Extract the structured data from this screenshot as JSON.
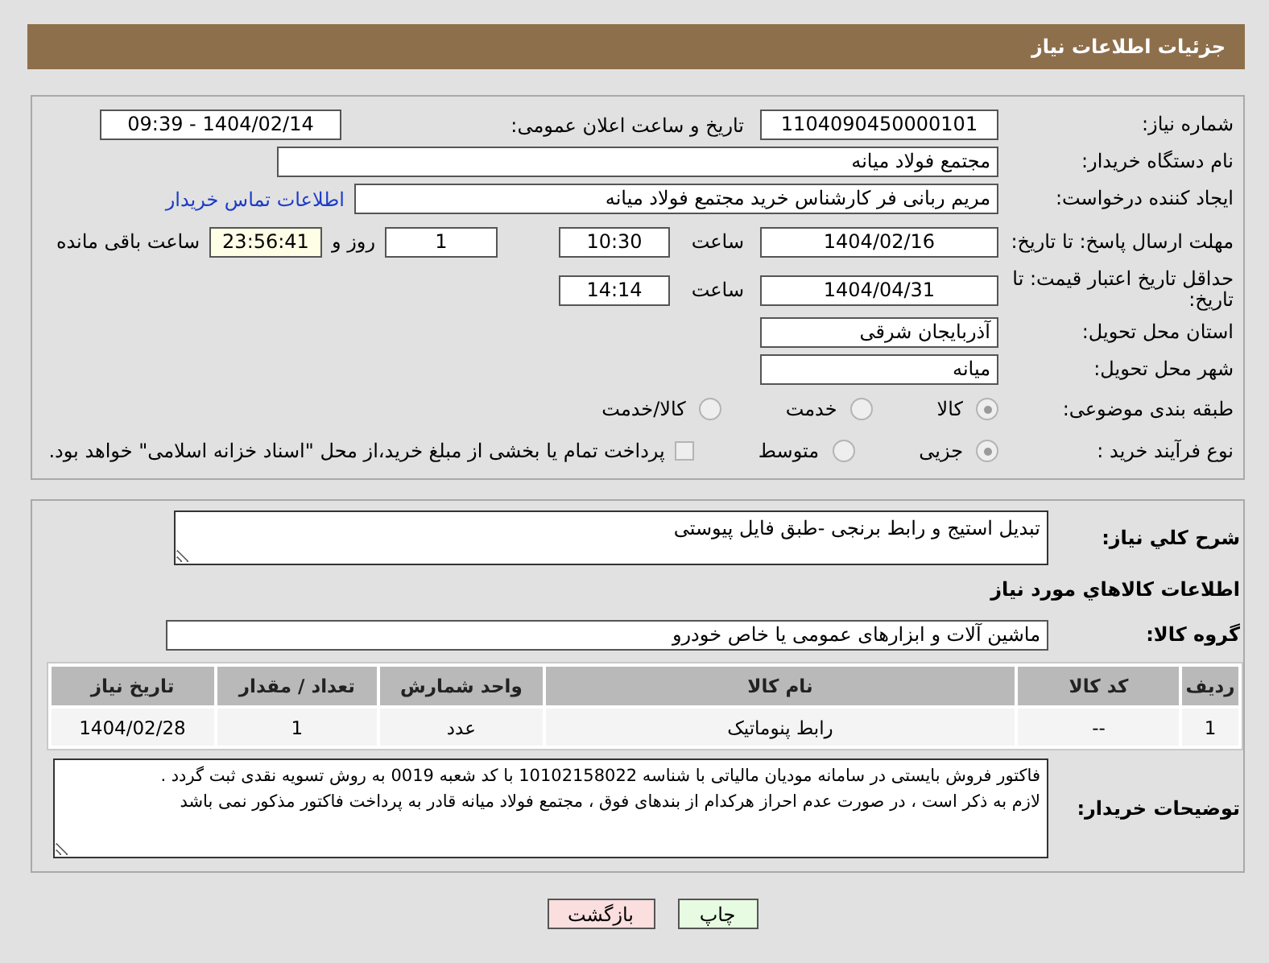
{
  "header": {
    "title": "جزئیات اطلاعات نیاز"
  },
  "need_number": {
    "label": "شماره نیاز:",
    "value": "1104090450000101"
  },
  "announce": {
    "label": "تاریخ و ساعت اعلان عمومی:",
    "value": "1404/02/14 - 09:39"
  },
  "buyer_org": {
    "label": "نام دستگاه خریدار:",
    "value": "مجتمع فولاد میانه"
  },
  "requester": {
    "label": "ایجاد کننده درخواست:",
    "value": "مریم ربانی فر کارشناس خرید مجتمع فولاد میانه",
    "link": "اطلاعات تماس خریدار"
  },
  "reply_deadline": {
    "label": "مهلت ارسال پاسخ: تا تاریخ:",
    "date": "1404/02/16",
    "time_label": "ساعت",
    "time": "10:30",
    "days": "1",
    "days_label": "روز و",
    "remaining": "23:56:41",
    "remaining_label": "ساعت باقی مانده"
  },
  "price_validity": {
    "label": "حداقل تاریخ اعتبار قیمت: تا تاریخ:",
    "date": "1404/04/31",
    "time_label": "ساعت",
    "time": "14:14"
  },
  "province": {
    "label": "استان محل تحویل:",
    "value": "آذربایجان شرقی"
  },
  "city": {
    "label": "شهر محل تحویل:",
    "value": "میانه"
  },
  "category": {
    "label": "طبقه بندی موضوعی:",
    "options": [
      {
        "label": "کالا",
        "selected": true
      },
      {
        "label": "خدمت",
        "selected": false
      },
      {
        "label": "کالا/خدمت",
        "selected": false
      }
    ]
  },
  "purchase_type": {
    "label": "نوع فرآیند خرید :",
    "options": [
      {
        "label": "جزیی",
        "selected": true
      },
      {
        "label": "متوسط",
        "selected": false
      }
    ],
    "payment": {
      "checked": false,
      "text": "پرداخت تمام یا بخشی از مبلغ خرید،از محل \"اسناد خزانه اسلامی\" خواهد بود."
    }
  },
  "description": {
    "label": "شرح کلي نياز:",
    "value": "تبدیل استیج و رابط برنجی -طبق فایل پیوستی"
  },
  "goods_title": "اطلاعات کالاهاي مورد نياز",
  "goods_group": {
    "label": "گروه کالا:",
    "value": "ماشین آلات و ابزارهای عمومی یا خاص خودرو"
  },
  "table": {
    "columns": [
      "ردیف",
      "کد کالا",
      "نام کالا",
      "واحد شمارش",
      "تعداد / مقدار",
      "تاریخ نیاز"
    ],
    "rows": [
      [
        "1",
        "--",
        "رابط پنوماتیک",
        "عدد",
        "1",
        "1404/02/28"
      ]
    ]
  },
  "buyer_notes": {
    "label": "توضیحات خریدار:",
    "value": "فاکتور فروش بایستی در سامانه مودیان مالیاتی با شناسه 10102158022 با کد شعبه 0019 به روش تسویه نقدی ثبت گردد .\nلازم به ذکر است ، در صورت عدم احراز هرکدام از بندهای فوق ، مجتمع فولاد میانه قادر به پرداخت فاکتور مذکور نمی باشد"
  },
  "buttons": [
    {
      "label": "چاپ",
      "kind": "print"
    },
    {
      "label": "بازگشت",
      "kind": "back"
    }
  ]
}
